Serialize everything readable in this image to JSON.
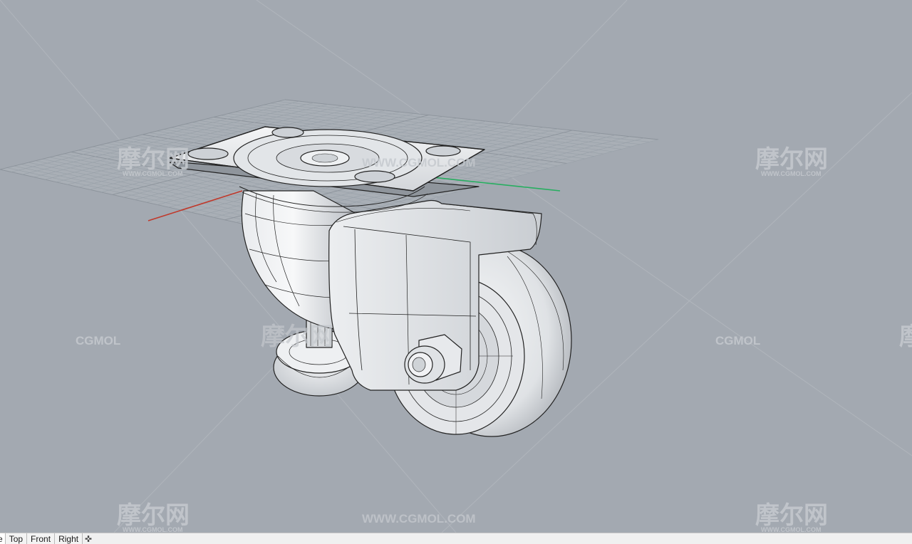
{
  "viewport": {
    "background": "#a3a9b1",
    "active_view": "Perspective",
    "axis_colors": {
      "x": "#c0392b",
      "y": "#27ae60"
    },
    "model": "swivel caster wheel (wireframe shaded)"
  },
  "watermarks": {
    "cn": "摩尔网",
    "sub": "WWW.CGMOL.COM",
    "url": "WWW.CGMOL.COM",
    "brand": "CGMOL",
    "color": "#c4c8cd"
  },
  "tabs": [
    {
      "label": "e"
    },
    {
      "label": "Top"
    },
    {
      "label": "Front"
    },
    {
      "label": "Right"
    }
  ],
  "add_tab_icon": "plus-icon"
}
